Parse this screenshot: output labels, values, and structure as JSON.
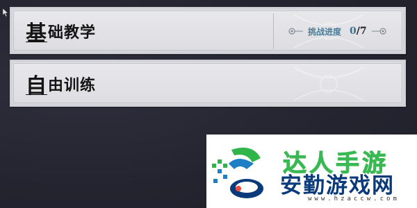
{
  "modes": [
    {
      "title_first_char": "基",
      "title_rest": "础教学",
      "progress_label": "挑战进度",
      "progress_current": "0",
      "progress_total": "/7"
    },
    {
      "title_first_char": "自",
      "title_rest": "由训练"
    }
  ],
  "watermark": {
    "brand_top": "达人手游",
    "brand_bottom": "安勤游戏网",
    "url": "www.hzaccw.com"
  },
  "colors": {
    "background": "#262733",
    "card": "#e4e4e8",
    "progress_accent": "#4a7f9a",
    "watermark_green": "#2fb54a",
    "watermark_blue": "#0a3a7a"
  },
  "icons": {
    "cursor": "mouse-pointer-icon",
    "progress_left": "node-left-icon",
    "progress_right": "node-right-icon"
  }
}
